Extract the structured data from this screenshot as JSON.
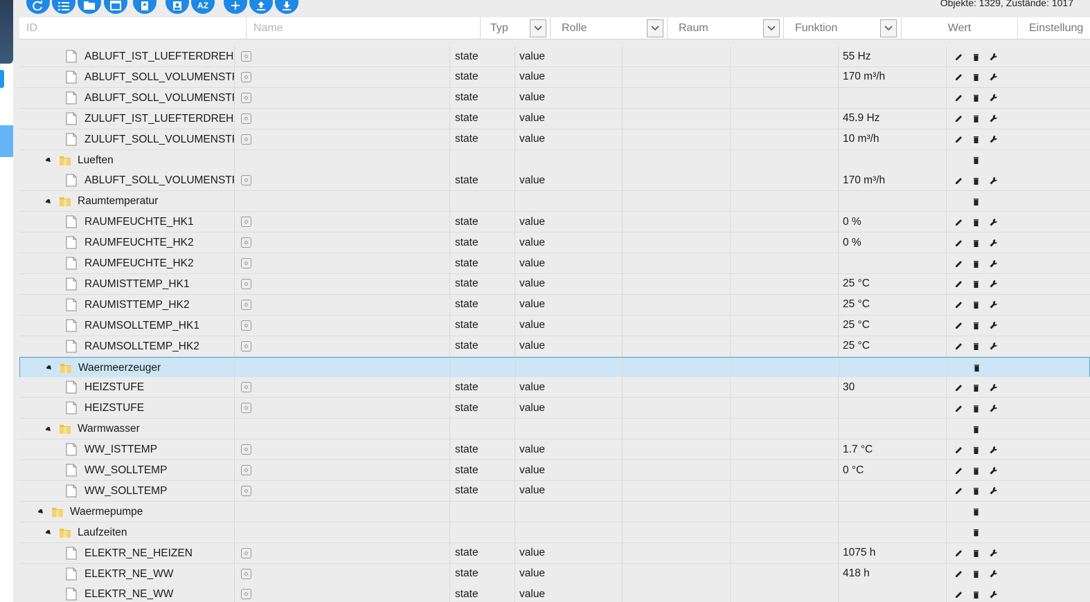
{
  "toolbar": {
    "sort_label": "AZ",
    "stats": "Objekte: 1329, Zustände: 1017"
  },
  "columns": {
    "id": "ID",
    "name": "Name",
    "typ": "Typ",
    "rolle": "Rolle",
    "raum": "Raum",
    "funktion": "Funktion",
    "wert": "Wert",
    "einstellung": "Einstellung"
  },
  "rows": [
    {
      "kind": "state",
      "level": 3,
      "label": "ABLUFT_IST_LUEFTERDREHZAHL",
      "typ": "state",
      "rolle": "value",
      "wert": "55 Hz"
    },
    {
      "kind": "state",
      "level": 3,
      "label": "ABLUFT_SOLL_VOLUMENSTROM",
      "typ": "state",
      "rolle": "value",
      "wert": "170 m³/h"
    },
    {
      "kind": "state",
      "level": 3,
      "label": "ABLUFT_SOLL_VOLUMENSTROM",
      "typ": "state",
      "rolle": "value",
      "wert": ""
    },
    {
      "kind": "state",
      "level": 3,
      "label": "ZULUFT_IST_LUEFTERDREHZAHL",
      "typ": "state",
      "rolle": "value",
      "wert": "45.9 Hz"
    },
    {
      "kind": "state",
      "level": 3,
      "label": "ZULUFT_SOLL_VOLUMENSTROM",
      "typ": "state",
      "rolle": "value",
      "wert": "10 m³/h"
    },
    {
      "kind": "folder",
      "level": 2,
      "label": "Lueften"
    },
    {
      "kind": "state",
      "level": 3,
      "label": "ABLUFT_SOLL_VOLUMENSTROM",
      "typ": "state",
      "rolle": "value",
      "wert": "170 m³/h"
    },
    {
      "kind": "folder",
      "level": 2,
      "label": "Raumtemperatur"
    },
    {
      "kind": "state",
      "level": 3,
      "label": "RAUMFEUCHTE_HK1",
      "typ": "state",
      "rolle": "value",
      "wert": "0 %"
    },
    {
      "kind": "state",
      "level": 3,
      "label": "RAUMFEUCHTE_HK2",
      "typ": "state",
      "rolle": "value",
      "wert": "0 %"
    },
    {
      "kind": "state",
      "level": 3,
      "label": "RAUMFEUCHTE_HK2",
      "typ": "state",
      "rolle": "value",
      "wert": ""
    },
    {
      "kind": "state",
      "level": 3,
      "label": "RAUMISTTEMP_HK1",
      "typ": "state",
      "rolle": "value",
      "wert": "25 °C"
    },
    {
      "kind": "state",
      "level": 3,
      "label": "RAUMISTTEMP_HK2",
      "typ": "state",
      "rolle": "value",
      "wert": "25 °C"
    },
    {
      "kind": "state",
      "level": 3,
      "label": "RAUMSOLLTEMP_HK1",
      "typ": "state",
      "rolle": "value",
      "wert": "25 °C"
    },
    {
      "kind": "state",
      "level": 3,
      "label": "RAUMSOLLTEMP_HK2",
      "typ": "state",
      "rolle": "value",
      "wert": "25 °C"
    },
    {
      "kind": "folder",
      "level": 2,
      "label": "Waermeerzeuger",
      "selected": true
    },
    {
      "kind": "state",
      "level": 3,
      "label": "HEIZSTUFE",
      "typ": "state",
      "rolle": "value",
      "wert": "30"
    },
    {
      "kind": "state",
      "level": 3,
      "label": "HEIZSTUFE",
      "typ": "state",
      "rolle": "value",
      "wert": ""
    },
    {
      "kind": "folder",
      "level": 2,
      "label": "Warmwasser"
    },
    {
      "kind": "state",
      "level": 3,
      "label": "WW_ISTTEMP",
      "typ": "state",
      "rolle": "value",
      "wert": "1.7 °C"
    },
    {
      "kind": "state",
      "level": 3,
      "label": "WW_SOLLTEMP",
      "typ": "state",
      "rolle": "value",
      "wert": "0 °C"
    },
    {
      "kind": "state",
      "level": 3,
      "label": "WW_SOLLTEMP",
      "typ": "state",
      "rolle": "value",
      "wert": ""
    },
    {
      "kind": "folder",
      "level": 1,
      "label": "Waermepumpe"
    },
    {
      "kind": "folder",
      "level": 2,
      "label": "Laufzeiten"
    },
    {
      "kind": "state",
      "level": 3,
      "label": "ELEKTR_NE_HEIZEN",
      "typ": "state",
      "rolle": "value",
      "wert": "1075 h"
    },
    {
      "kind": "state",
      "level": 3,
      "label": "ELEKTR_NE_WW",
      "typ": "state",
      "rolle": "value",
      "wert": "418 h"
    },
    {
      "kind": "state",
      "level": 3,
      "label": "ELEKTR_NE_WW",
      "typ": "state",
      "rolle": "value",
      "wert": ""
    }
  ],
  "icons": {
    "toolbar": [
      "refresh-icon",
      "list-icon",
      "folder-icon",
      "window-icon",
      "upload-file-icon",
      "user-icon",
      "sort-az-icon",
      "add-icon",
      "upload-icon",
      "download-icon"
    ],
    "row_actions": [
      "edit-icon",
      "delete-icon",
      "settings-wrench-icon"
    ]
  },
  "colors": {
    "accent": "#1e88e5",
    "selected_row": "#cde6f5",
    "folder": "#e8c14a"
  }
}
